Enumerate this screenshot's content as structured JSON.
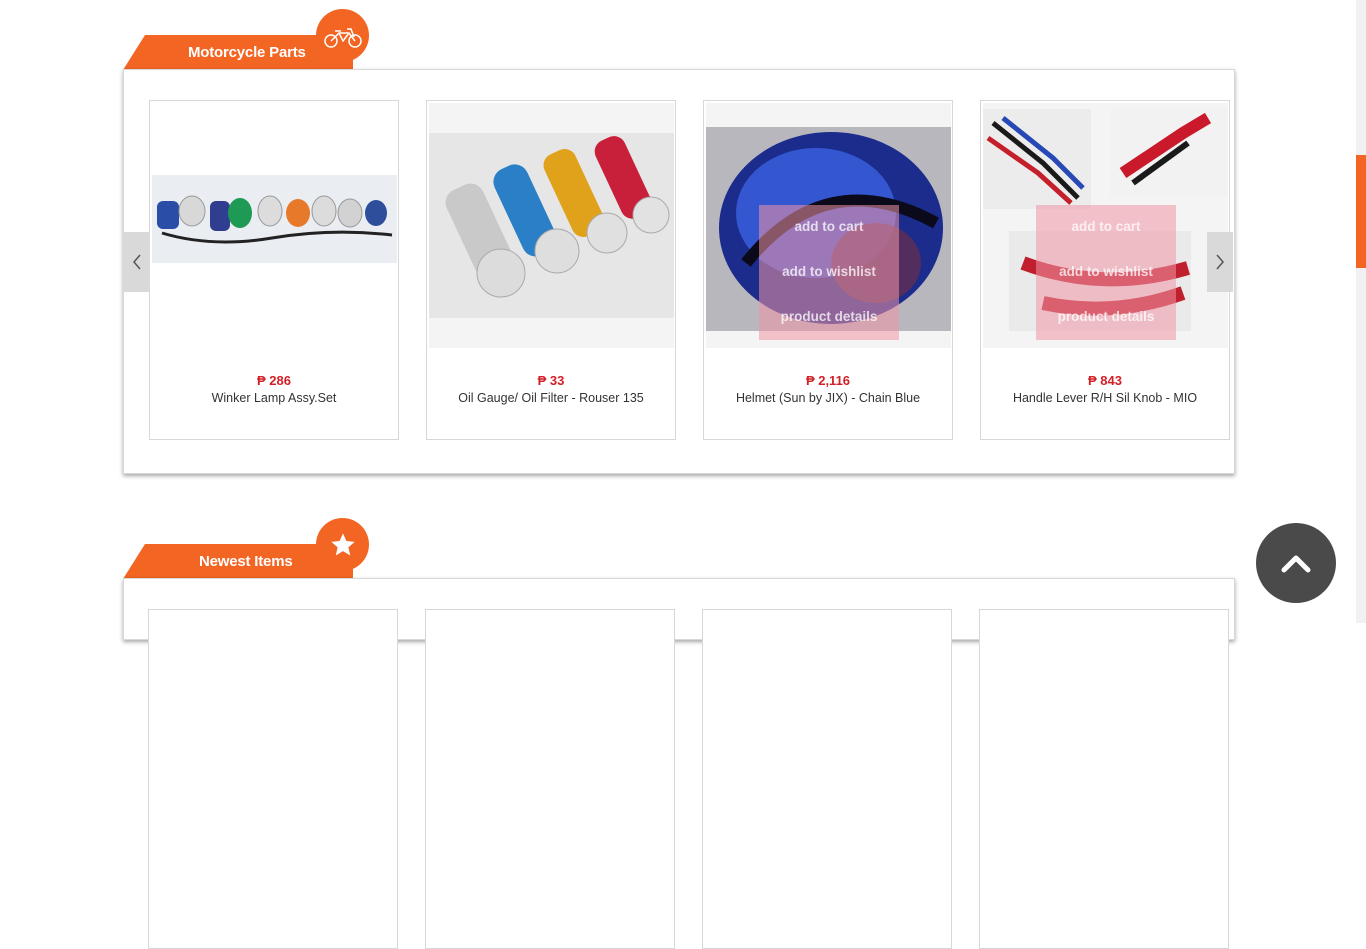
{
  "sections": [
    {
      "title": "Motorcycle Parts",
      "icon": "motorcycle-icon",
      "products": [
        {
          "price": "₱ 286",
          "name": "Winker Lamp Assy.Set"
        },
        {
          "price": "₱ 33",
          "name": "Oil Gauge/ Oil Filter - Rouser 135"
        },
        {
          "price": "₱ 2,116",
          "name": "Helmet (Sun by JIX) - Chain Blue"
        },
        {
          "price": "₱ 843",
          "name": "Handle Lever R/H Sil Knob - MIO"
        }
      ],
      "hover_actions": {
        "add_to_cart": "add to cart",
        "add_to_wishlist": "add to wishlist",
        "product_details": "product details"
      }
    },
    {
      "title": "Newest Items",
      "icon": "star-icon"
    }
  ],
  "colors": {
    "accent": "#f26522",
    "price": "#d31f26",
    "back_to_top": "#4a4a4a"
  },
  "icons": {
    "prev": "chevron-left-icon",
    "next": "chevron-right-icon",
    "back_to_top": "chevron-up-icon"
  }
}
